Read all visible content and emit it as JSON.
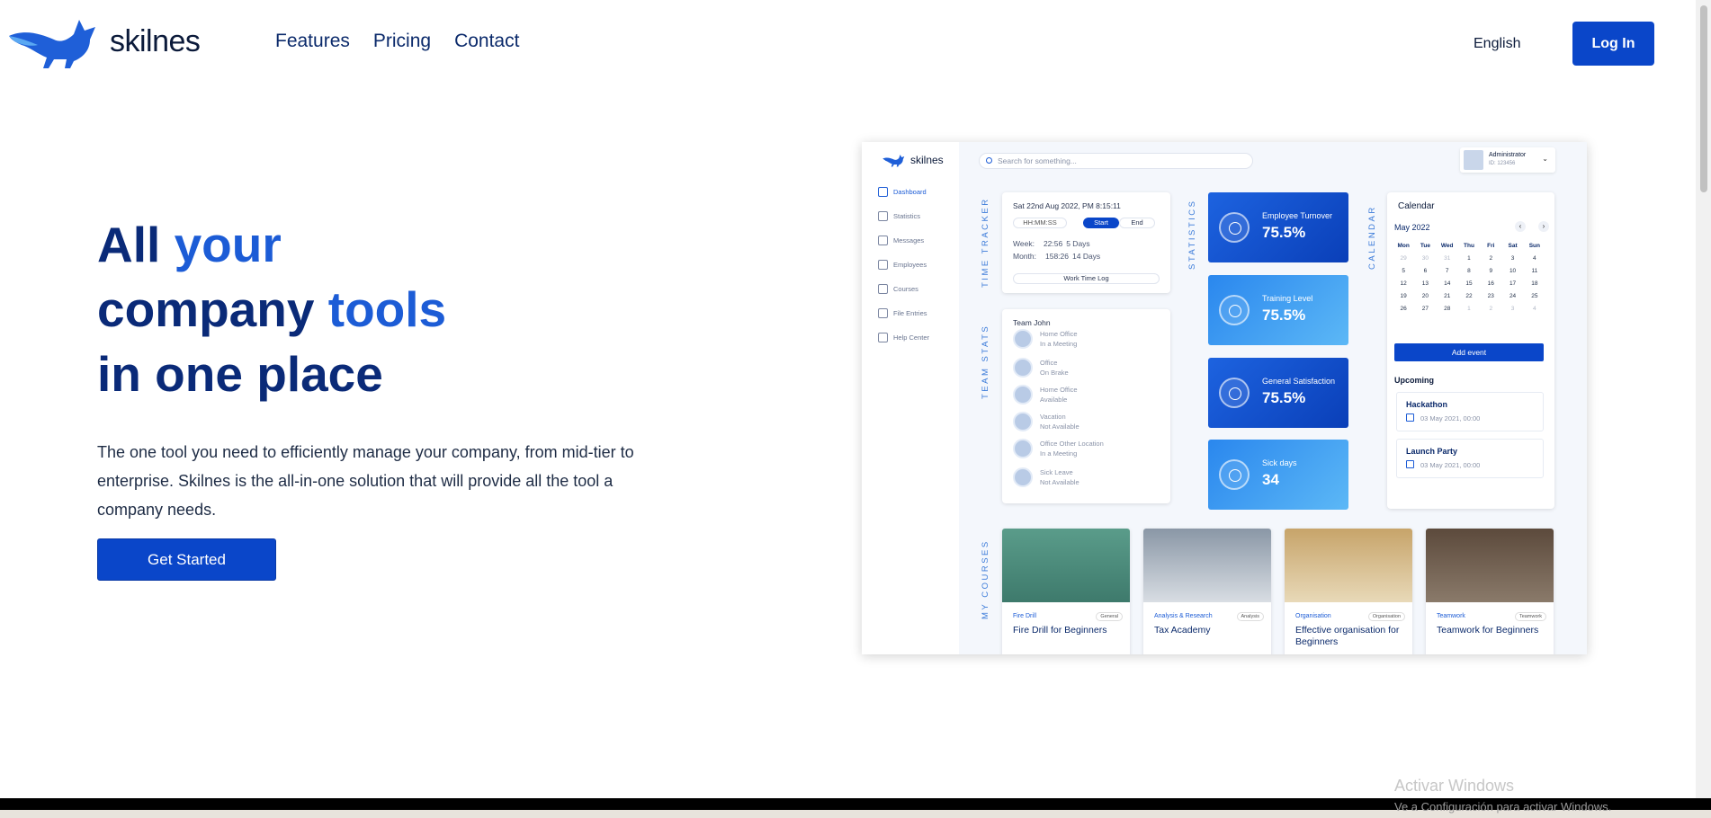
{
  "brand": {
    "name": "skilnes",
    "colors": {
      "primary": "#0a46c9",
      "heading": "#0a2a78",
      "accent": "#1c5cd6"
    }
  },
  "nav": {
    "items": [
      "Features",
      "Pricing",
      "Contact"
    ]
  },
  "header": {
    "language": "English",
    "login": "Log In"
  },
  "hero": {
    "title_line1_a": "All ",
    "title_line1_b": "your",
    "title_line2_a": "company ",
    "title_line2_b": "tools",
    "title_line3": "in one place",
    "lead": "The one tool you need to efficiently manage your company, from mid-tier to enterprise. Skilnes is the all-in-one solution that will provide all the tool a company needs.",
    "cta": "Get Started"
  },
  "mock": {
    "logo": "skilnes",
    "search_placeholder": "Search for something...",
    "admin": {
      "name": "Administrator",
      "id": "ID: 123456"
    },
    "sidebar": [
      "Dashboard",
      "Statistics",
      "Messages",
      "Employees",
      "Courses",
      "File Entries",
      "Help Center"
    ],
    "section_labels": {
      "time": "TIME TRACKER",
      "team": "TEAM STATS",
      "stats": "STATISTICS",
      "calendar": "CALENDAR",
      "courses": "MY COURSES"
    },
    "time_tracker": {
      "date": "Sat 22nd Aug 2022, PM 8:15:11",
      "hms": "HH:MM:SS",
      "start": "Start",
      "end": "End",
      "week_label": "Week:",
      "week_time": "22:56",
      "week_days": "5 Days",
      "month_label": "Month:",
      "month_time": "158:26",
      "month_days": "14 Days",
      "log": "Work Time Log"
    },
    "team": {
      "title": "Team John",
      "members": [
        {
          "place": "Home Office",
          "status": "In a Meeting"
        },
        {
          "place": "Office",
          "status": "On Brake"
        },
        {
          "place": "Home Office",
          "status": "Available"
        },
        {
          "place": "Vacation",
          "status": "Not Available"
        },
        {
          "place": "Office Other Location",
          "status": "In a Meeting"
        },
        {
          "place": "Sick Leave",
          "status": "Not Available"
        }
      ]
    },
    "stats": [
      {
        "label": "Employee Turnover",
        "value": "75.5%"
      },
      {
        "label": "Training Level",
        "value": "75.5%"
      },
      {
        "label": "General Satisfaction",
        "value": "75.5%"
      },
      {
        "label": "Sick days",
        "value": "34"
      }
    ],
    "calendar": {
      "title": "Calendar",
      "month": "May 2022",
      "days": [
        "Mon",
        "Tue",
        "Wed",
        "Thu",
        "Fri",
        "Sat",
        "Sun"
      ],
      "add": "Add event",
      "upcoming": "Upcoming",
      "events": [
        {
          "title": "Hackathon",
          "date": "03 May 2021, 00:00"
        },
        {
          "title": "Launch Party",
          "date": "03 May 2021, 00:00"
        }
      ]
    },
    "courses": [
      {
        "category": "Fire Drill",
        "tag": "General",
        "title": "Fire Drill for Beginners"
      },
      {
        "category": "Analysis & Research",
        "tag": "Analysis",
        "title": "Tax Academy"
      },
      {
        "category": "Organisation",
        "tag": "Organisation",
        "title": "Effective organisation for Beginners"
      },
      {
        "category": "Teamwork",
        "tag": "Teamwork",
        "title": "Teamwork for Beginners"
      }
    ]
  },
  "watermark": {
    "line1": "Activar Windows",
    "line2": "Ve a Configuración para activar Windows."
  }
}
